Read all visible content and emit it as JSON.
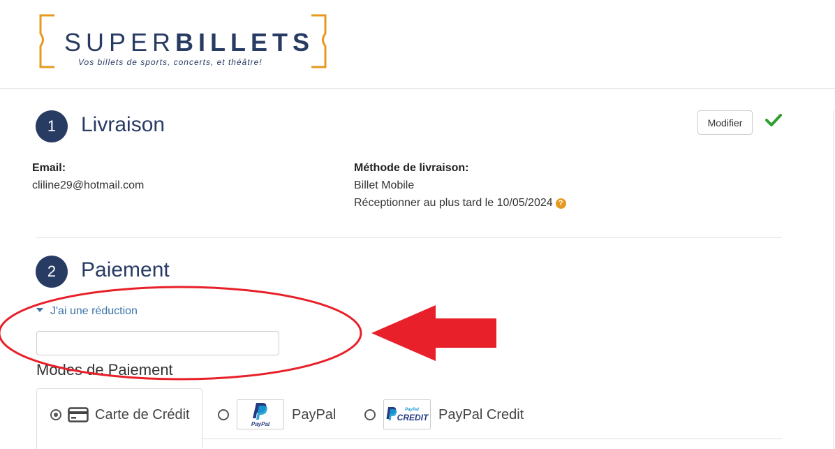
{
  "brand": {
    "name_light": "SUPER",
    "name_bold": "BILLETS",
    "tagline": "Vos billets de sports, concerts, et théâtre!"
  },
  "delivery": {
    "step_number": "1",
    "title": "Livraison",
    "modify_label": "Modifier",
    "email_label": "Email:",
    "email_value": "cliline29@hotmail.com",
    "method_label": "Méthode de livraison:",
    "method_value": "Billet Mobile",
    "deadline_text": "Réceptionner au plus tard le 10/05/2024",
    "help_glyph": "?"
  },
  "payment": {
    "step_number": "2",
    "title": "Paiement",
    "reduction_toggle": "J'ai une réduction",
    "discount_value": "",
    "modes_heading": "Modes de Paiement",
    "methods": [
      {
        "label": "Carte de Crédit",
        "icon": "credit-card-icon",
        "selected": true
      },
      {
        "label": "PayPal",
        "icon": "paypal-logo",
        "selected": false
      },
      {
        "label": "PayPal Credit",
        "icon": "paypal-credit-logo",
        "selected": false
      }
    ]
  },
  "colors": {
    "brand_navy": "#283b63",
    "brand_orange": "#e59a1f",
    "link_blue": "#3a73a9",
    "success_green": "#2e9e2e",
    "annotation_red": "#e8202a"
  }
}
